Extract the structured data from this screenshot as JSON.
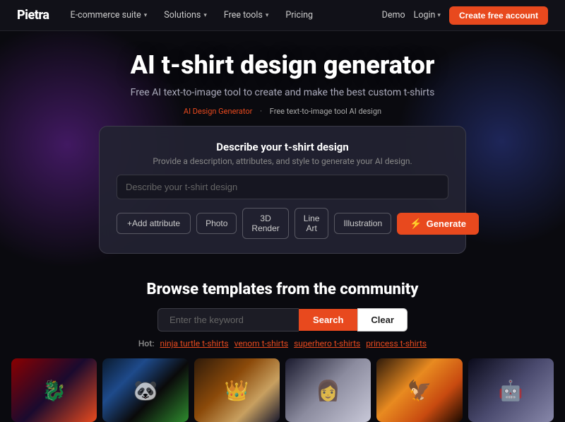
{
  "nav": {
    "logo": "Pietra",
    "items": [
      {
        "label": "E-commerce suite",
        "has_dropdown": true
      },
      {
        "label": "Solutions",
        "has_dropdown": true
      },
      {
        "label": "Free tools",
        "has_dropdown": true
      },
      {
        "label": "Pricing",
        "has_dropdown": false
      }
    ],
    "right": {
      "demo": "Demo",
      "login": "Login",
      "create_account": "Create free account"
    }
  },
  "hero": {
    "title": "AI t-shirt design generator",
    "subtitle": "Free AI text-to-image tool to create and make the best custom t-shirts",
    "breadcrumb": {
      "prefix": "AI Design Generator",
      "sep": "·",
      "suffix": "Free text-to-image tool AI design"
    }
  },
  "design_card": {
    "title": "Describe your t-shirt design",
    "subtitle": "Provide a description, attributes, and style to generate your AI design.",
    "input_placeholder": "Describe your t-shirt design",
    "buttons": {
      "add_attribute": "+Add attribute",
      "photo": "Photo",
      "render_3d": "3D Render",
      "line_art": "Line Art",
      "illustration": "Illustration",
      "generate": "Generate"
    }
  },
  "browse": {
    "title": "Browse templates from the community",
    "search_placeholder": "Enter the keyword",
    "btn_search": "Search",
    "btn_clear": "Clear",
    "hot_label": "Hot:",
    "hot_tags": [
      "ninja turtle t-shirts",
      "venom t-shirts",
      "superhero t-shirts",
      "princess t-shirts"
    ]
  },
  "templates": [
    {
      "id": 1,
      "icon": "🐉"
    },
    {
      "id": 2,
      "icon": "🐼"
    },
    {
      "id": 3,
      "icon": "👑"
    },
    {
      "id": 4,
      "icon": "👩"
    },
    {
      "id": 5,
      "icon": "🦅"
    },
    {
      "id": 6,
      "icon": "🤖"
    }
  ],
  "colors": {
    "accent": "#e8491e",
    "bg_dark": "#0a0a0f",
    "nav_bg": "#111118"
  }
}
